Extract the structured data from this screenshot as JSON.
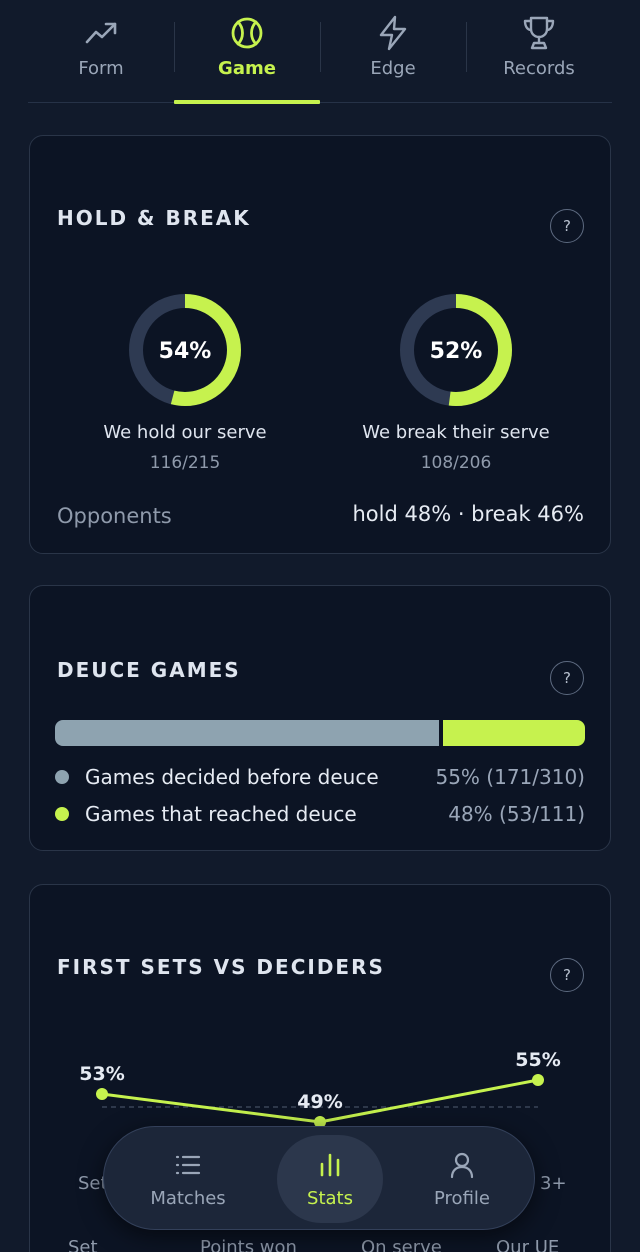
{
  "tabs": [
    {
      "label": "Form",
      "icon": "trend-up-icon",
      "active": false
    },
    {
      "label": "Game",
      "icon": "tennis-ball-icon",
      "active": true
    },
    {
      "label": "Edge",
      "icon": "lightning-icon",
      "active": false
    },
    {
      "label": "Records",
      "icon": "trophy-icon",
      "active": false
    }
  ],
  "hold_break": {
    "title": "HOLD & BREAK",
    "help": "?",
    "hold": {
      "percent": 54,
      "percent_text": "54%",
      "label": "We hold our serve",
      "fraction": "116/215"
    },
    "break": {
      "percent": 52,
      "percent_text": "52%",
      "label": "We break their serve",
      "fraction": "108/206"
    },
    "opponents_label": "Opponents",
    "opponents_value": "hold 48% · break 46%"
  },
  "deuce": {
    "title": "DEUCE GAMES",
    "help": "?",
    "bar_fraction_before_deuce": 0.73,
    "items": [
      {
        "label": "Games decided before deuce",
        "value": "55% (171/310)",
        "color": "#8ea3b0"
      },
      {
        "label": "Games that reached deuce",
        "value": "48% (53/111)",
        "color": "#c6f24e"
      }
    ]
  },
  "first_sets": {
    "title": "FIRST SETS VS DECIDERS",
    "help": "?",
    "category_left": "Set",
    "category_right": "3+",
    "bottom_labels": [
      "Set",
      "Points won",
      "On serve",
      "Our UE"
    ]
  },
  "chart_data": {
    "type": "line",
    "values": [
      53,
      49,
      55
    ],
    "data_labels": [
      "53%",
      "49%",
      "55%"
    ]
  },
  "bottom_nav": [
    {
      "label": "Matches",
      "icon": "list-icon",
      "active": false
    },
    {
      "label": "Stats",
      "icon": "bar-chart-icon",
      "active": true
    },
    {
      "label": "Profile",
      "icon": "user-icon",
      "active": false
    }
  ],
  "colors": {
    "accent": "#c6f24e",
    "background": "#111a2b",
    "card": "#0c1424",
    "ring_track": "#2e3a52",
    "muted_bar": "#8ea3b0"
  }
}
